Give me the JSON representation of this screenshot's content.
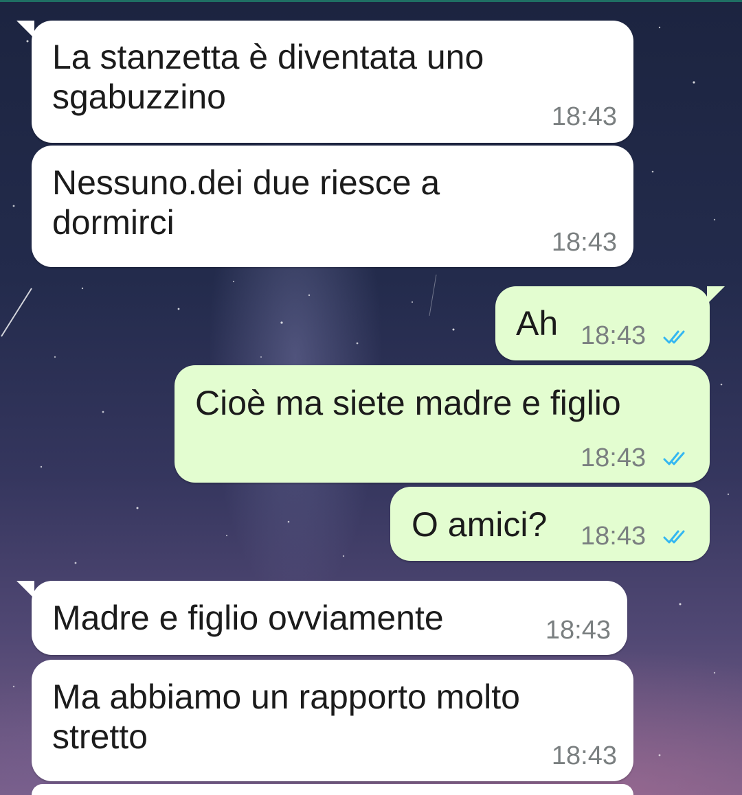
{
  "conversation": {
    "messages": [
      {
        "direction": "incoming",
        "text": "La stanzetta è diventata uno\nsgabuzzino",
        "time": "18:43"
      },
      {
        "direction": "incoming",
        "text": "Nessuno.dei due riesce a\ndormirci",
        "time": "18:43"
      },
      {
        "direction": "outgoing",
        "text": "Ah",
        "time": "18:43",
        "status": "read"
      },
      {
        "direction": "outgoing",
        "text": "Cioè ma siete madre e figlio",
        "time": "18:43",
        "status": "read"
      },
      {
        "direction": "outgoing",
        "text": "O amici?",
        "time": "18:43",
        "status": "read"
      },
      {
        "direction": "incoming",
        "text": "Madre e figlio ovviamente",
        "time": "18:43"
      },
      {
        "direction": "incoming",
        "text": "Ma abbiamo un rapporto molto\nstretto",
        "time": "18:43"
      }
    ]
  },
  "colors": {
    "incoming_bubble": "#ffffff",
    "outgoing_bubble": "#e3fdd0",
    "read_ticks": "#34b7f1",
    "time_text": "#7a7f80"
  },
  "icons": {
    "read_status": "double-check-icon"
  }
}
